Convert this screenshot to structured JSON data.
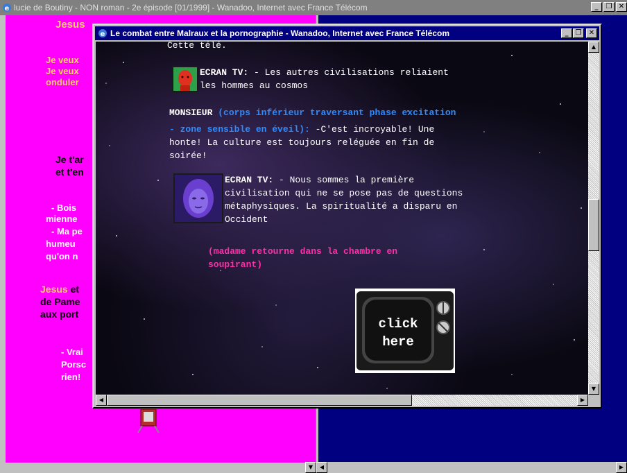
{
  "outer_window": {
    "title": "lucie de Boutiny - NON roman - 2e épisode [01/1999] - Wanadoo, Internet avec France Télécom",
    "buttons": {
      "minimize": "_",
      "restore": "❒",
      "close": "✕"
    }
  },
  "background_page": {
    "jesus_top": "Jesus",
    "lines_yellow": [
      "Je veux",
      "Je veux",
      "onduler"
    ],
    "lines_black": [
      "Je t'ar",
      "et t'en"
    ],
    "lines_white": [
      "- Bois",
      "mienne",
      "- Ma pe",
      "humeu",
      "qu'on n"
    ],
    "jesus_mid": "Jesus",
    "jesus_mid_rest": " et",
    "lines_black_2": [
      "de Pame",
      "aux port"
    ],
    "lines_white_2": [
      "- Vrai",
      "Porsc",
      "rien!"
    ]
  },
  "popup": {
    "title": "Le combat entre Malraux et la pornographie - Wanadoo, Internet avec France Télécom",
    "buttons": {
      "minimize": "_",
      "restore": "❒",
      "close": "✕"
    },
    "top_partial": "Cette télé.",
    "ecran1_speaker": "ECRAN TV:",
    "ecran1_line1": " - Les autres civilisations reliaient",
    "ecran1_line2": "les hommes au cosmos",
    "monsieur_speaker": "MONSIEUR",
    "monsieur_stage_1": " (corps inférieur traversant phase excitation",
    "monsieur_stage_2": "- zone sensible en éveil):",
    "monsieur_line1": " -C'est incroyable! Une",
    "monsieur_line2": "honte! La culture est toujours reléguée en fin de",
    "monsieur_line3": "soirée!",
    "ecran2_speaker": "ECRAN TV:",
    "ecran2_line1": " - Nous sommes la première",
    "ecran2_line2": "civilisation qui ne se pose pas de questions",
    "ecran2_line3": "métaphysiques. La spiritualité a disparu en",
    "ecran2_line4": "Occident",
    "stage_madame_1": "(madame retourne dans la chambre en",
    "stage_madame_2": "soupirant)",
    "click_here_1": "click",
    "click_here_2": "here"
  },
  "colors": {
    "pink_frame": "#ff00ff",
    "blue_frame": "#000080",
    "stage_blue": "#2d8cff",
    "stage_pink": "#ff2ea8",
    "title_active": "#000080",
    "title_inactive": "#808080"
  },
  "icons": [
    "ie-icon",
    "tv-icon",
    "avatar-man-icon",
    "avatar-woman-icon"
  ]
}
